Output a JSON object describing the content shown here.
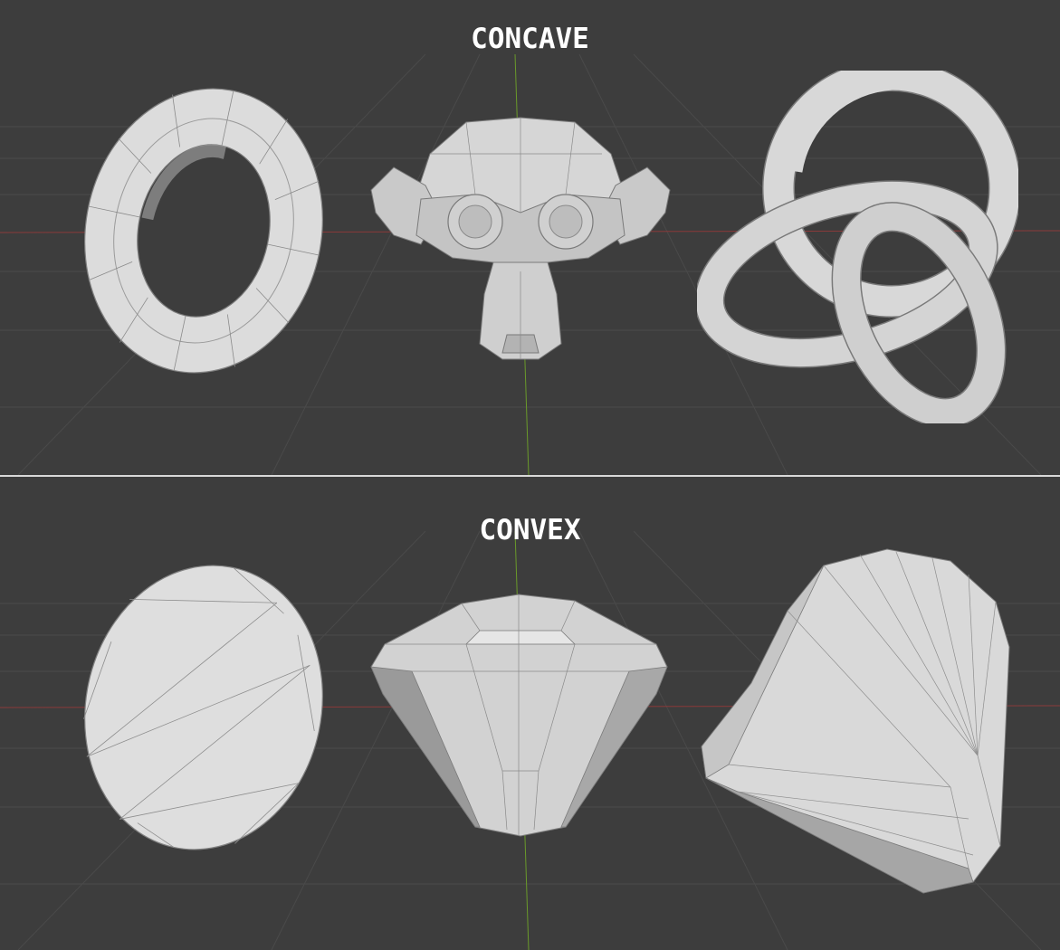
{
  "panels": {
    "top": {
      "title": "CONCAVE",
      "objects": [
        "torus",
        "monkey-head",
        "trefoil-knot"
      ]
    },
    "bottom": {
      "title": "CONVEX",
      "objects": [
        "torus-convex-hull",
        "monkey-convex-hull",
        "knot-convex-hull"
      ]
    }
  },
  "colors": {
    "background": "#3d3d3d",
    "grid_line": "#4a4a4a",
    "x_axis": "#8a3a3a",
    "y_axis": "#6a9a2a",
    "mesh_light": "#e2e2e2",
    "mesh_mid": "#bdbdbd",
    "mesh_dark": "#8c8c8c",
    "edge": "#7a7a7a",
    "divider": "#d9d9d9",
    "title": "#ffffff"
  }
}
